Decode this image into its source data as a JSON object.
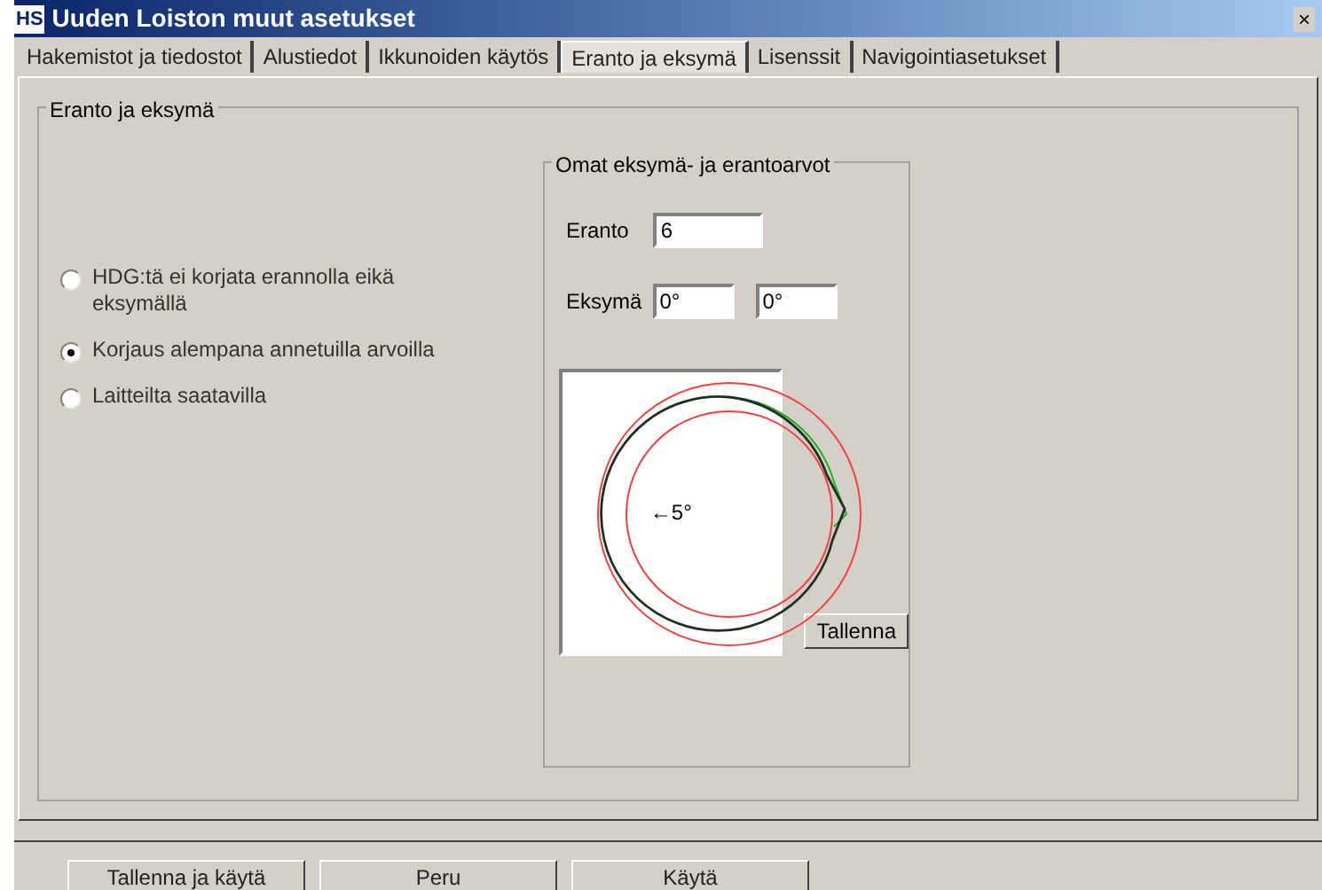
{
  "window": {
    "title": "Uuden Loiston muut asetukset",
    "logo": "HS",
    "close": "×"
  },
  "tabs": [
    {
      "label": "Hakemistot ja tiedostot",
      "selected": false
    },
    {
      "label": "Alustiedot",
      "selected": false
    },
    {
      "label": "Ikkunoiden käytös",
      "selected": false
    },
    {
      "label": "Eranto ja eksymä",
      "selected": true
    },
    {
      "label": "Lisenssit",
      "selected": false
    },
    {
      "label": "Navigointiasetukset",
      "selected": false
    }
  ],
  "group": {
    "title": "Eranto ja eksymä",
    "options": [
      {
        "label": "HDG:tä ei korjata erannolla eikä eksymällä",
        "selected": false
      },
      {
        "label": "Korjaus alempana annetuilla arvoilla",
        "selected": true
      },
      {
        "label": "Laitteilta saatavilla",
        "selected": false
      }
    ],
    "custom": {
      "title": "Omat eksymä- ja erantoarvot",
      "eranto_label": "Eranto",
      "eranto_value": "6",
      "eksyma_label": "Eksymä",
      "eksyma_values": [
        "0°",
        "0°"
      ],
      "diagram_label": "←5°",
      "save": "Tallenna"
    }
  },
  "buttons": [
    "Tallenna ja käytä",
    "Peru",
    "Käytä"
  ]
}
